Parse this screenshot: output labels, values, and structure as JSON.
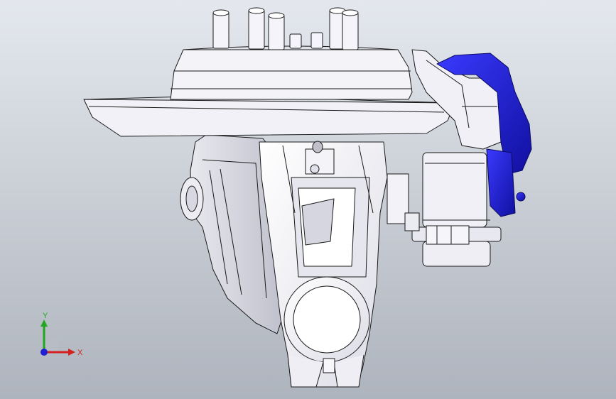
{
  "viewport": {
    "background_top": "#e4e8ee",
    "background_bottom": "#aeb4bd"
  },
  "model": {
    "part_color": "#f2f2f6",
    "edge_color": "#1a1a1a",
    "accent_color": "#1f1fd6"
  },
  "triad": {
    "x_label": "X",
    "y_label": "Y",
    "x_color": "#d42020",
    "y_color": "#1fa81f",
    "z_color": "#1f1fd6"
  }
}
